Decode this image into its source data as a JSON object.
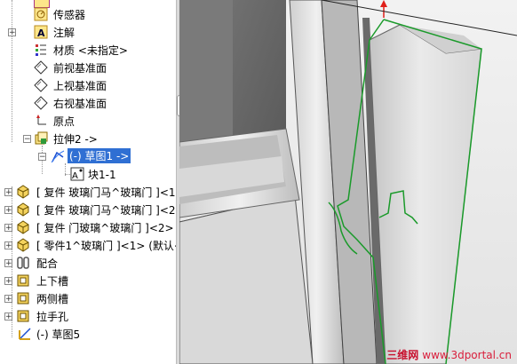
{
  "tree": {
    "items": [
      {
        "label": "传感器",
        "icon": "sensor-icon"
      },
      {
        "label": "注解",
        "icon": "annotation-icon"
      },
      {
        "label": "材质 <未指定>",
        "icon": "material-icon"
      },
      {
        "label": "前视基准面",
        "icon": "plane-icon"
      },
      {
        "label": "上视基准面",
        "icon": "plane-icon"
      },
      {
        "label": "右视基准面",
        "icon": "plane-icon"
      },
      {
        "label": "原点",
        "icon": "origin-icon"
      },
      {
        "label": "拉伸2 ->",
        "icon": "extrude-icon"
      },
      {
        "label": "(-) 草图1 ->",
        "icon": "sketch-icon",
        "selected": true
      },
      {
        "label": "块1-1",
        "icon": "block-icon"
      },
      {
        "label": "[ 复件 玻璃门马^玻璃门 ]<1",
        "icon": "part-icon"
      },
      {
        "label": "[ 复件 玻璃门马^玻璃门 ]<2",
        "icon": "part-icon"
      },
      {
        "label": "[ 复件 门玻璃^玻璃门 ]<2>",
        "icon": "part-icon"
      },
      {
        "label": "[ 零件1^玻璃门 ]<1> (默认<",
        "icon": "part-icon"
      },
      {
        "label": "配合",
        "icon": "mate-icon"
      },
      {
        "label": "上下槽",
        "icon": "feature-icon"
      },
      {
        "label": "两侧槽",
        "icon": "feature-icon"
      },
      {
        "label": "拉手孔",
        "icon": "feature-icon"
      },
      {
        "label": "(-) 草图5",
        "icon": "sketch-icon"
      }
    ]
  },
  "watermark": {
    "brand": "三维网",
    "url": "www.3dportal.cn"
  },
  "colors": {
    "selection": "#2f6fd3",
    "sketch_green": "#1a9a2a",
    "arrow_red": "#e0201a"
  }
}
